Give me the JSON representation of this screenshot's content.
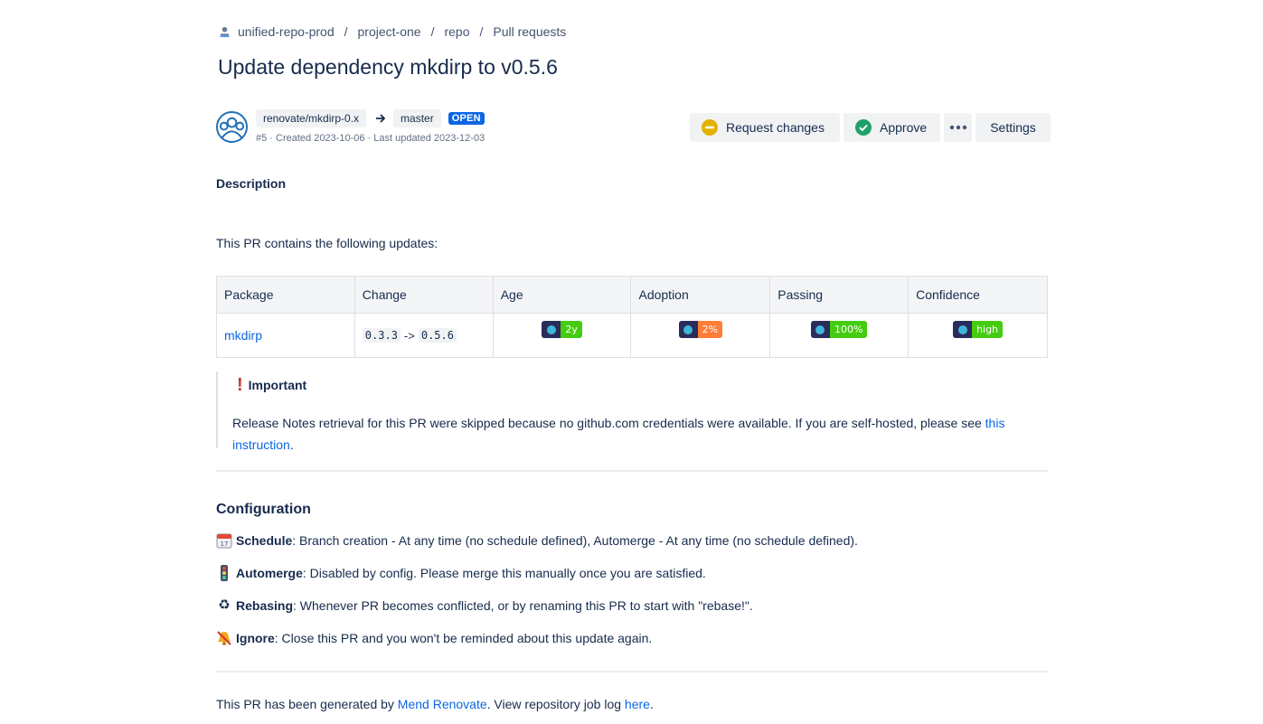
{
  "breadcrumb": {
    "workspace": "unified-repo-prod",
    "project": "project-one",
    "repo": "repo",
    "section": "Pull requests",
    "separator": "/"
  },
  "pr": {
    "title": "Update dependency mkdirp to v0.5.6",
    "source_branch": "renovate/mkdirp-0.x",
    "target_branch": "master",
    "status": "OPEN",
    "meta": "#5 · Created 2023-10-06 · Last updated 2023-12-03"
  },
  "actions": {
    "request_changes": "Request changes",
    "approve": "Approve",
    "settings": "Settings"
  },
  "description": {
    "heading": "Description",
    "intro": "This PR contains the following updates:"
  },
  "table": {
    "headers": [
      "Package",
      "Change",
      "Age",
      "Adoption",
      "Passing",
      "Confidence"
    ],
    "row": {
      "package": "mkdirp",
      "from": "0.3.3",
      "arrow": "->",
      "to": "0.5.6",
      "age": "2y",
      "adoption": "2%",
      "passing": "100%",
      "confidence": "high"
    }
  },
  "note": {
    "title": "Important",
    "text": "Release Notes retrieval for this PR were skipped because no github.com credentials were available. If you are self-hosted, please see ",
    "link": "this instruction",
    "end": "."
  },
  "configuration": {
    "heading": "Configuration",
    "schedule_label": "Schedule",
    "schedule_text": ": Branch creation - At any time (no schedule defined), Automerge - At any time (no schedule defined).",
    "automerge_label": "Automerge",
    "automerge_text": ": Disabled by config. Please merge this manually once you are satisfied.",
    "rebasing_label": "Rebasing",
    "rebasing_text": ": Whenever PR becomes conflicted, or by renaming this PR to start with \"rebase!\".",
    "ignore_label": "Ignore",
    "ignore_text": ": Close this PR and you won't be reminded about this update again."
  },
  "footer": {
    "prefix": "This PR has been generated by ",
    "link1": "Mend Renovate",
    "middle": ". View repository job log ",
    "link2": "here",
    "end": "."
  },
  "colors": {
    "link": "#0c66e4",
    "badge_green": "#4c1",
    "badge_orange": "#fe7d37",
    "badge_dark": "#2a2c5b",
    "open_lozenge": "#0c66e4",
    "request_changes_icon": "#e2b203",
    "approve_icon": "#22a06b"
  }
}
